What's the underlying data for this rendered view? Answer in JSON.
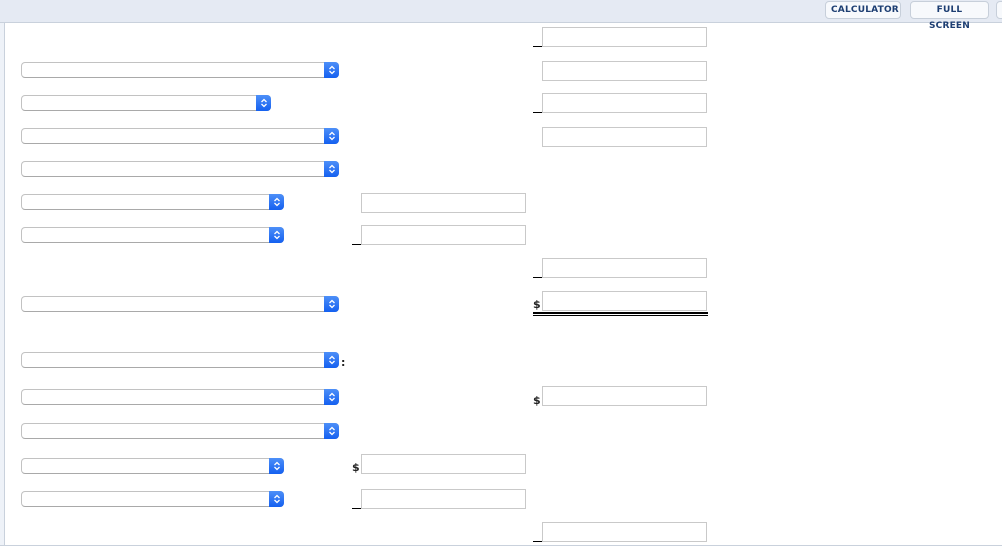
{
  "toolbar": {
    "calculator_label": "CALCULATOR",
    "fullscreen_label": "FULL SCREEN"
  },
  "form": {
    "selects": [
      {
        "selected": ""
      },
      {
        "selected": ""
      },
      {
        "selected": ""
      },
      {
        "selected": ""
      },
      {
        "selected": ""
      },
      {
        "selected": ""
      },
      {
        "selected": ""
      },
      {
        "selected": ""
      },
      {
        "selected": ""
      },
      {
        "selected": ""
      },
      {
        "selected": ""
      },
      {
        "selected": ""
      }
    ],
    "col1_inputs": [
      {
        "value": ""
      },
      {
        "value": ""
      },
      {
        "value": ""
      },
      {
        "value": ""
      }
    ],
    "col2_inputs": [
      {
        "value": ""
      },
      {
        "value": ""
      },
      {
        "value": ""
      },
      {
        "value": ""
      },
      {
        "value": ""
      },
      {
        "value": ""
      },
      {
        "value": ""
      },
      {
        "value": ""
      }
    ],
    "currency_symbol": "$",
    "colon": ":"
  }
}
